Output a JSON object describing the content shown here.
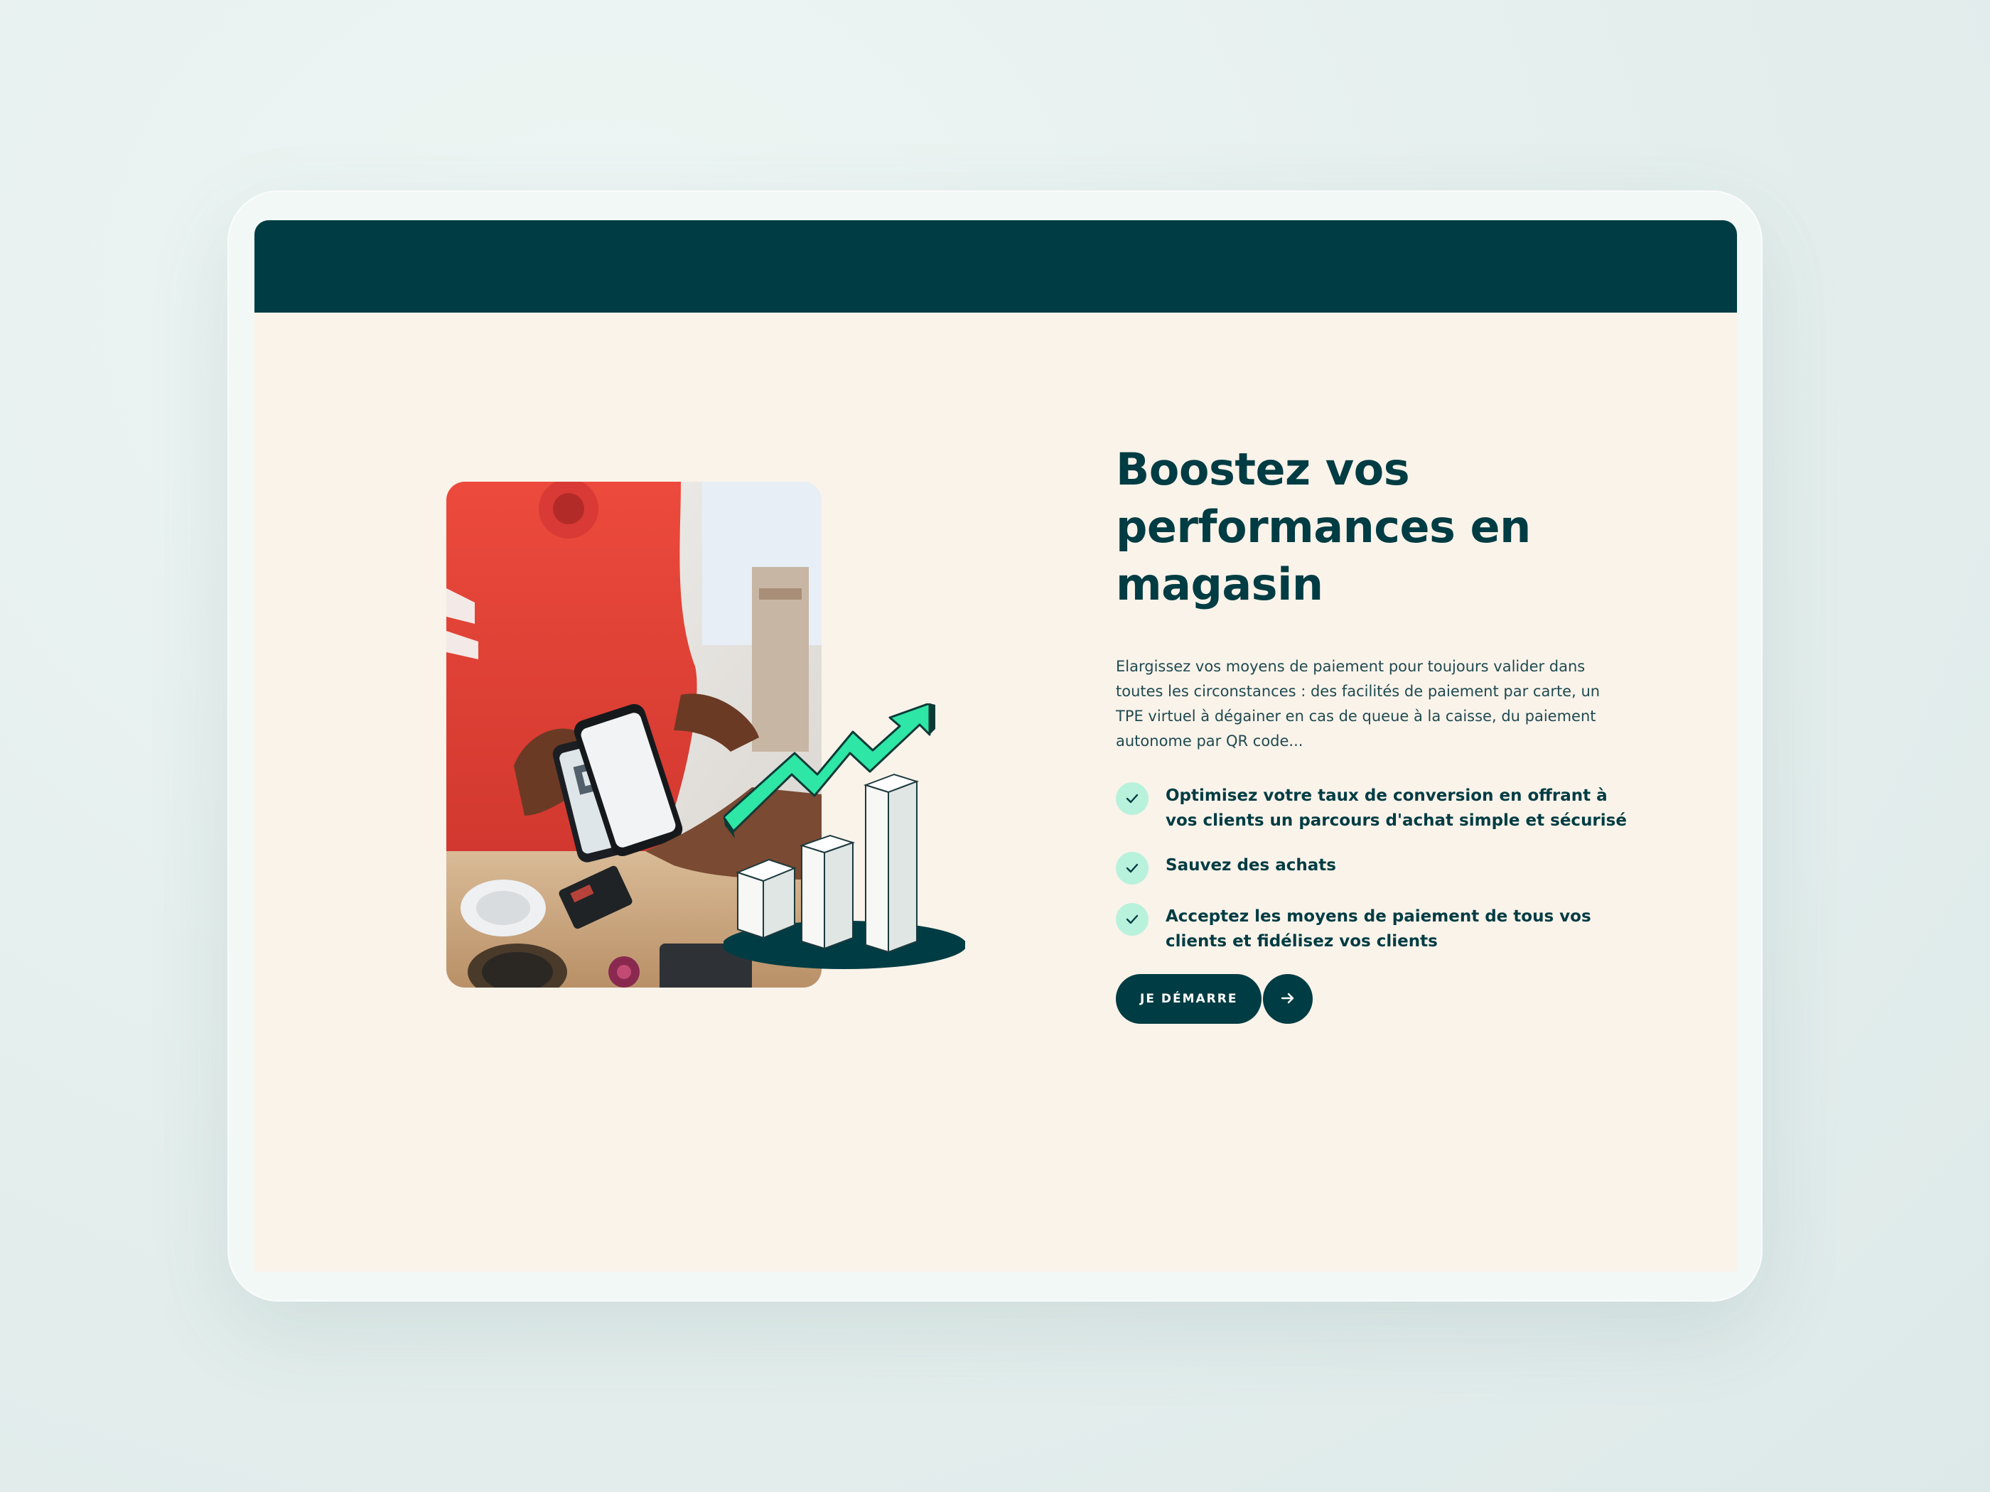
{
  "colors": {
    "primary": "#003c43",
    "accent": "#3ef0b2",
    "background": "#faf3ea",
    "check_background": "#b8f2dc"
  },
  "hero": {
    "title": "Boostez vos performances en magasin",
    "intro": "Elargissez vos moyens de paiement pour toujours valider dans toutes les circonstances : des facilités de paiement par carte, un TPE virtuel à dégainer en cas de queue à la caisse, du paiement autonome par QR code...",
    "bullets": [
      {
        "icon": "check-icon",
        "text": "Optimisez votre taux de conversion en offrant à vos clients un parcours d'achat simple et sécurisé"
      },
      {
        "icon": "check-icon",
        "text": "Sauvez des achats"
      },
      {
        "icon": "check-icon",
        "text": "Acceptez les moyens de paiement de tous vos clients et fidélisez vos clients"
      }
    ],
    "cta": {
      "label": "JE DÉMARRE",
      "icon": "arrow-right-icon"
    }
  },
  "media": {
    "photo": "photo-mobile-payment",
    "illustration": "growth-chart-illustration"
  }
}
